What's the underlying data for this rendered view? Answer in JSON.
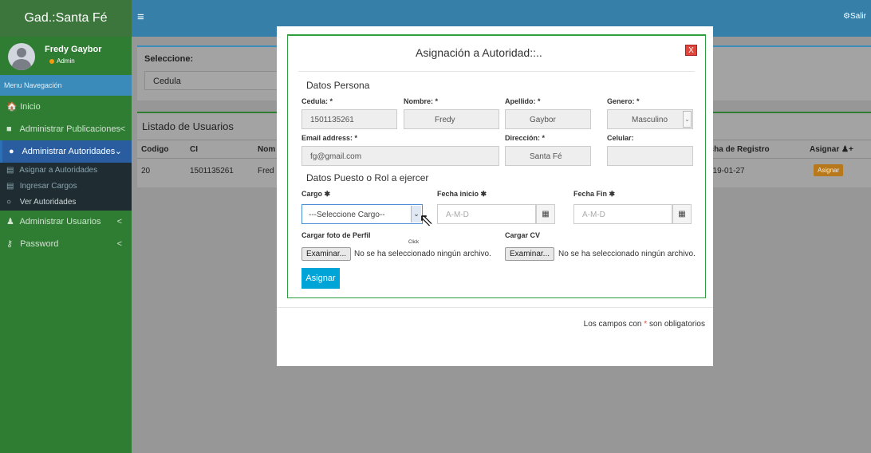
{
  "header": {
    "logo": "Gad.:Santa Fé",
    "menu_toggle": "≡",
    "logout": "⚙Salir"
  },
  "sidebar": {
    "user_name": "Fredy Gaybor",
    "user_role": "Admin",
    "menu_header": "Menu Navegación",
    "items": [
      {
        "icon": "home-icon",
        "glyph": "🏠",
        "label": "Inicio"
      },
      {
        "icon": "edit-icon",
        "glyph": "■",
        "label": "Administrar Publicaciones",
        "chevron": "<"
      },
      {
        "icon": "dashboard-icon",
        "glyph": "●",
        "label": "Administrar Autoridades",
        "chevron": "⌄"
      },
      {
        "icon": "user-icon",
        "glyph": "♟",
        "label": "Administrar Usuarios",
        "chevron": "<"
      },
      {
        "icon": "key-icon",
        "glyph": "⚷",
        "label": "Password",
        "chevron": "<"
      }
    ],
    "subitems": [
      {
        "icon": "list-icon",
        "glyph": "▤",
        "label": "Asignar a Autoridades"
      },
      {
        "icon": "list-icon",
        "glyph": "▤",
        "label": "Ingresar Cargos"
      },
      {
        "icon": "circle-icon",
        "glyph": "○",
        "label": "Ver Autoridades"
      }
    ]
  },
  "select_panel": {
    "label": "Seleccione:",
    "value": "Cedula"
  },
  "list_panel": {
    "title": "Listado de Usuarios",
    "columns": [
      "Codigo",
      "CI",
      "Nom",
      "echa de Registro",
      "Asignar"
    ],
    "row": {
      "codigo": "20",
      "ci": "1501135261",
      "nombre": "Fred",
      "fecha": "019-01-27",
      "action": "Asignar"
    }
  },
  "modal": {
    "title": "Asignación a Autoridad::..",
    "close_label": "X",
    "section_persona": "Datos Persona",
    "labels": {
      "cedula": "Cedula: *",
      "nombre": "Nombre: *",
      "apellido": "Apellido: *",
      "genero": "Genero: *",
      "email": "Email address: *",
      "direccion": "Dirección: *",
      "celular": "Celular:"
    },
    "values": {
      "cedula": "1501135261",
      "nombre": "Fredy",
      "apellido": "Gaybor",
      "genero": "Masculino",
      "email": "fg@gmail.com",
      "direccion": "Santa Fé",
      "celular": ""
    },
    "section_puesto": "Datos Puesto o Rol a ejercer",
    "cargo_label": "Cargo ✱",
    "cargo_value": "---Seleccione Cargo--",
    "fecha_inicio_label": "Fecha inicio ✱",
    "fecha_inicio_placeholder": "A-M-D",
    "fecha_fin_label": "Fecha Fin ✱",
    "fecha_fin_placeholder": "A-M-D",
    "foto_label": "Cargar foto de Perfil",
    "cv_label": "Cargar CV",
    "browse_label": "Examinar...",
    "no_file": "No se ha seleccionado ningún archivo.",
    "submit": "Asignar",
    "cursor_hint": "Click",
    "required_note_prefix": "Los campos con ",
    "required_note_star": "*",
    "required_note_suffix": " son obligatorios"
  }
}
